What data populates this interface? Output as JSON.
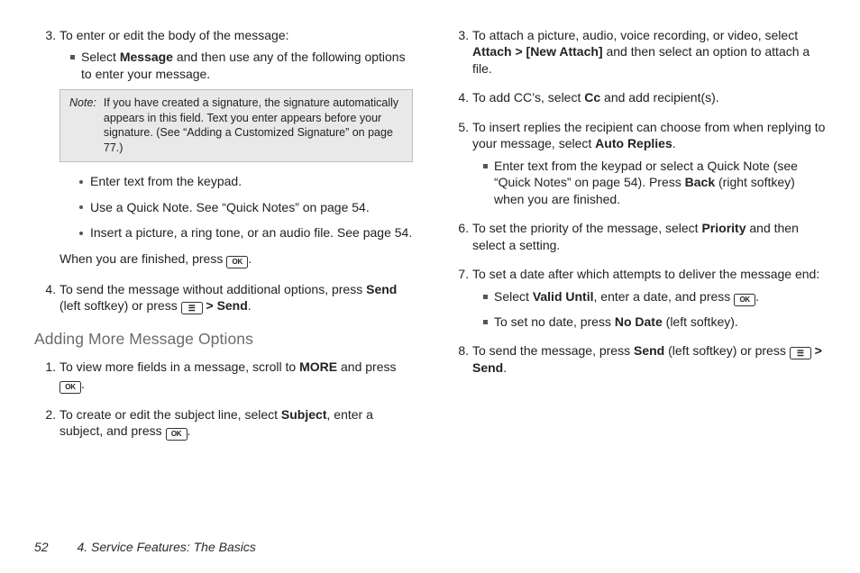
{
  "left": {
    "item3": {
      "lead": "To enter or edit the body of the message:",
      "sq1_a": "Select ",
      "sq1_b": "Message",
      "sq1_c": " and then use any of the following options to enter your message.",
      "note_label": "Note:",
      "note_text": "If you have created a signature, the signature automatically appears in this field. Text you enter appears before your signature. (See “Adding a Customized Signature” on page 77.)",
      "b1": "Enter text from the keypad.",
      "b2": "Use a Quick Note. See “Quick Notes” on page 54.",
      "b3": "Insert a picture, a ring tone, or an audio file. See page 54.",
      "after_a": "When you are finished, press ",
      "after_b": ".",
      "ok": "OK"
    },
    "item4": {
      "a": "To send the message without additional options, press ",
      "send1": "Send",
      "b": " (left softkey) or press ",
      "menu": "☰",
      "gt": " > ",
      "send2": "Send",
      "c": "."
    },
    "subhead": "Adding More Message Options",
    "more1": {
      "a": "To view more fields in a message, scroll to ",
      "more": "MORE",
      "b": " and press ",
      "ok": "OK",
      "c": "."
    },
    "more2": {
      "a": "To create or edit the subject line, select ",
      "subject": "Subject",
      "b": ", enter a subject, and press ",
      "ok": "OK",
      "c": "."
    }
  },
  "right": {
    "item3": {
      "a": "To attach a picture, audio, voice recording, or video, select ",
      "attach": "Attach",
      "gt": " > ",
      "new": "[New Attach]",
      "b": " and then select an option to attach a file."
    },
    "item4": {
      "a": "To add CC’s, select ",
      "cc": "Cc",
      "b": " and add recipient(s)."
    },
    "item5": {
      "a": "To insert replies the recipient can choose from when replying to your message, select ",
      "auto": "Auto Replies",
      "b": ".",
      "sq_a": "Enter text from the keypad or select a Quick Note (see “Quick Notes” on page 54). Press ",
      "back": "Back",
      "sq_b": " (right softkey) when you are finished."
    },
    "item6": {
      "a": "To set the priority of the message, select ",
      "priority": "Priority",
      "b": " and then select a setting."
    },
    "item7": {
      "a": "To set a date after which attempts to deliver the message end:",
      "sq1_a": "Select ",
      "valid": "Valid Until",
      "sq1_b": ", enter a date, and press ",
      "ok": "OK",
      "sq1_c": ".",
      "sq2_a": "To set no date, press ",
      "nodate": "No Date",
      "sq2_b": " (left softkey)."
    },
    "item8": {
      "a": "To send the message, press ",
      "send1": "Send",
      "b": " (left softkey) or press ",
      "menu": "☰",
      "gt": " > ",
      "send2": "Send",
      "c": "."
    }
  },
  "footer": {
    "page": "52",
    "title": "4. Service Features: The Basics"
  }
}
